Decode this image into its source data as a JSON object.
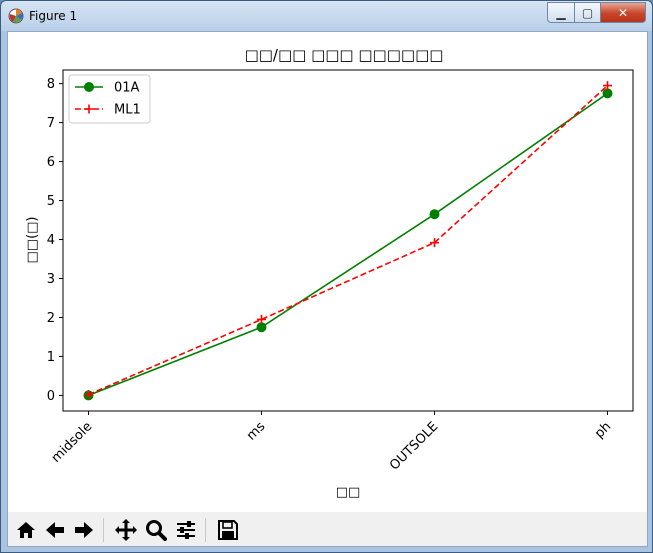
{
  "window": {
    "title": "Figure 1",
    "min_symbol": "▁",
    "max_symbol": "▢",
    "close_symbol": "✕"
  },
  "chart_data": {
    "type": "line",
    "title": "□□/□□ □□□ □□□□□□",
    "xlabel": "□□",
    "ylabel": "□□(□)",
    "categories": [
      "midsole",
      "ms",
      "OUTSOLE",
      "ph"
    ],
    "ylim": [
      -0.4,
      8.35
    ],
    "yticks": [
      0,
      1,
      2,
      3,
      4,
      5,
      6,
      7,
      8
    ],
    "grid": false,
    "legend_position": "top-left",
    "series": [
      {
        "name": "01A",
        "values": [
          0.0,
          1.75,
          4.65,
          7.75
        ],
        "color": "#008000",
        "linestyle": "solid",
        "marker": "circle"
      },
      {
        "name": "ML1",
        "values": [
          0.02,
          1.95,
          3.92,
          7.95
        ],
        "color": "#ff0000",
        "linestyle": "dashed",
        "marker": "plus"
      }
    ]
  },
  "toolbar": {
    "icons": [
      "home-icon",
      "back-icon",
      "forward-icon",
      "pan-icon",
      "zoom-icon",
      "configure-subplots-icon",
      "save-icon"
    ]
  }
}
